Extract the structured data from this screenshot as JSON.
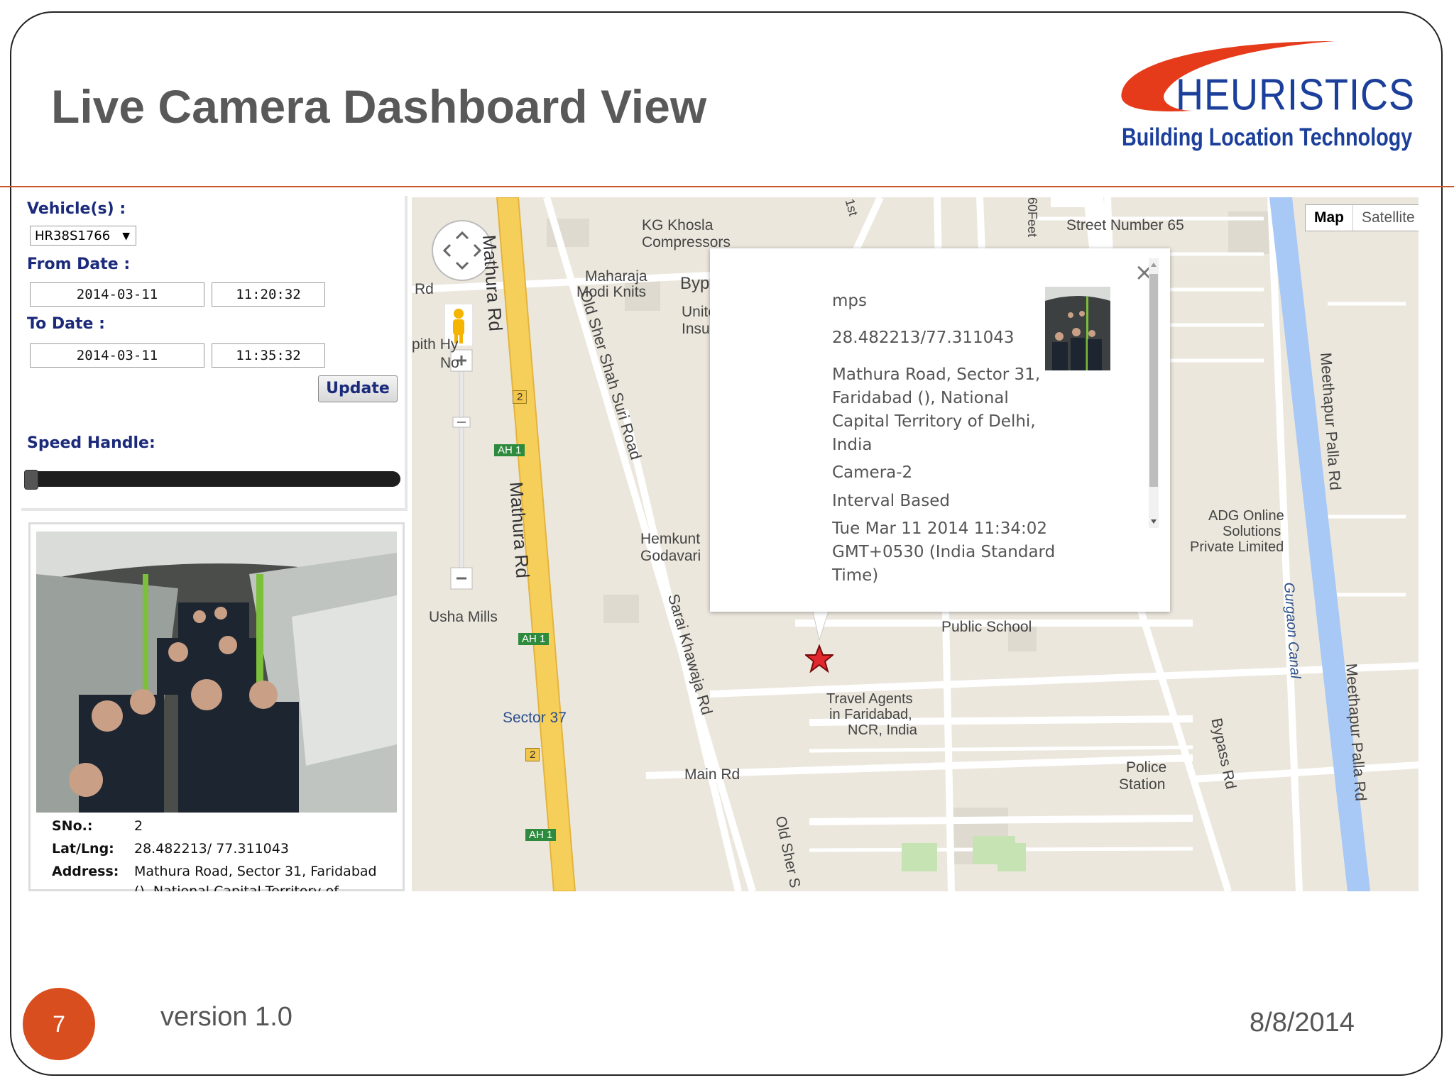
{
  "slide": {
    "title": "Live Camera Dashboard View",
    "logo": {
      "name": "HEURISTICS",
      "tagline": "Building Location Technology"
    },
    "page_number": "7",
    "version": "version 1.0",
    "date": "8/8/2014"
  },
  "controls": {
    "vehicle_label": "Vehicle(s) :",
    "vehicle_value": "HR38S1766",
    "from_label": "From Date :",
    "from_date": "2014-03-11",
    "from_time": "11:20:32",
    "to_label": "To Date :",
    "to_date": "2014-03-11",
    "to_time": "11:35:32",
    "update_label": "Update",
    "speed_label": "Speed Handle:",
    "speed_level": 0.0
  },
  "record": {
    "sno_label": "SNo.:",
    "sno": "2",
    "latlng_label": "Lat/Lng:",
    "latlng": "28.482213/ 77.311043",
    "address_label": "Address:",
    "address_line1": "Mathura Road, Sector 31, Faridabad",
    "address_line2": "(), National Capital Territory of"
  },
  "map": {
    "map_button": "Map",
    "satellite_button": "Satellite",
    "labels": {
      "kg_khosla": "KG Khosla",
      "compressors": "Compressors",
      "maharaja": "Maharaja",
      "modi_knits": "Modi Knits",
      "bypass": "Bypass",
      "unite": "Unite",
      "insu": "Insu",
      "street65": "Street Number 65",
      "mathura_rd_1": "Mathura Rd",
      "mathura_rd_2": "Mathura Rd",
      "old_sher_shah": "Old Sher Shah Suri Road",
      "hemkunt": "Hemkunt",
      "godavari": "Godavari",
      "usha_mills": "Usha Mills",
      "sector37": "Sector 37",
      "sarai": "Sarai Khawaja Rd",
      "main_rd": "Main Rd",
      "old_sher_2": "Old Sher S",
      "travel1": "Travel Agents",
      "travel2": "in Faridabad,",
      "travel3": "NCR, India",
      "public_school": "Public School",
      "police1": "Police",
      "police2": "Station",
      "bypass_rd": "Bypass Rd",
      "adg1": "ADG Online",
      "adg2": "Solutions",
      "adg3": "Private Limited",
      "meethapur1": "Meethapur Palla Rd",
      "meethapur2": "Meethapur Palla Rd",
      "gurgaon": "Gurgaon Canal",
      "rd": "Rd",
      "pith1": "pith Hy",
      "pith2": "No",
      "first": "1st",
      "sixty": "60Feet",
      "ah1": "AH 1",
      "two": "2"
    },
    "popup": {
      "speed": "mps",
      "coords": "28.482213/77.311043",
      "address1": "Mathura Road, Sector 31,",
      "address2": "Faridabad (), National",
      "address3": "Capital Territory of Delhi,",
      "address4": "India",
      "camera": "Camera-2",
      "mode": "Interval Based",
      "time1": "Tue Mar 11 2014 11:34:02",
      "time2": "GMT+0530 (India Standard",
      "time3": "Time)",
      "close": "×"
    }
  },
  "colors": {
    "accent": "#d94e1f",
    "label_blue": "#1b2a7a",
    "logo_blue": "#1b3f9a",
    "logo_red": "#e53b1a",
    "road_yellow": "#f6cf5a",
    "canal_blue": "#a8c8f5"
  }
}
